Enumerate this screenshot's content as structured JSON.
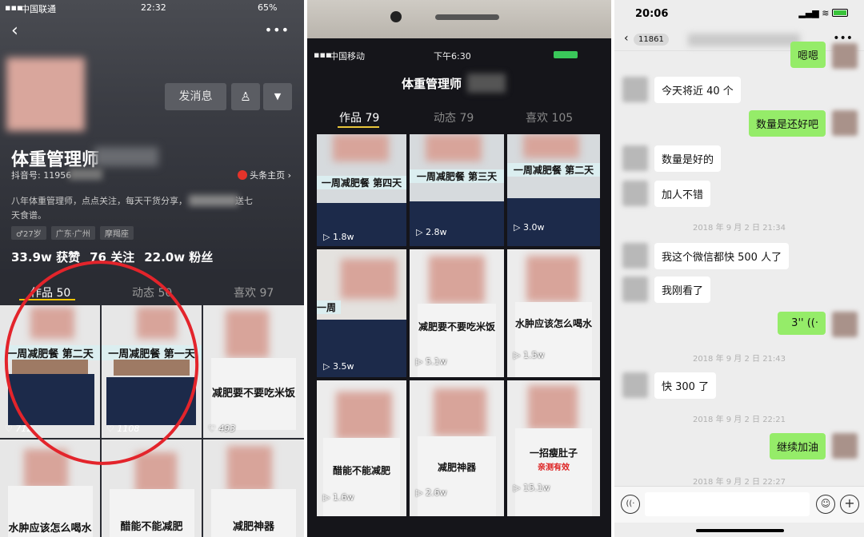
{
  "panel1": {
    "status": {
      "carrier": "中国联通",
      "time": "22:32",
      "battery": "65%"
    },
    "buttons": {
      "message": "发消息"
    },
    "profile": {
      "name": "体重管理师",
      "id_prefix": "抖音号: 11956",
      "toutiao": "头条主页 ›",
      "bio_line1": "八年体重管理师，点点关注，每天干货分享，",
      "bio_tail": "送七",
      "bio_line2": "天食谱。",
      "tags": [
        "♂27岁",
        "广东·广州",
        "摩羯座"
      ],
      "stats": [
        "33.9w 获赞",
        "76 关注",
        "22.0w 粉丝"
      ]
    },
    "tabs": [
      "作品 50",
      "动态 50",
      "喜欢 97"
    ],
    "grid": [
      {
        "label": "一周减肥餐 第二天",
        "likes": "♡ 712"
      },
      {
        "label": "一周减肥餐 第一天",
        "likes": "♡ 1108"
      },
      {
        "label": "减肥要不要吃米饭",
        "likes": "♡ 493"
      },
      {
        "label": "水肿应该怎么喝水",
        "likes": ""
      },
      {
        "label": "醋能不能减肥",
        "likes": ""
      },
      {
        "label": "减肥神器",
        "likes": ""
      }
    ],
    "highlight_color": "#e3242b"
  },
  "panel2": {
    "status": {
      "carrier": "中国移动",
      "time": "下午6:30"
    },
    "title": "体重管理师",
    "tabs": [
      "作品 79",
      "动态 79",
      "喜欢 105"
    ],
    "grid": [
      {
        "label": "一周减肥餐 第四天",
        "plays": "▷ 1.8w"
      },
      {
        "label": "一周减肥餐 第三天",
        "plays": "▷ 2.8w"
      },
      {
        "label": "一周减肥餐 第二天",
        "plays": "▷ 3.0w"
      },
      {
        "label": "一周",
        "plays": "▷ 3.5w"
      },
      {
        "label": "减肥要不要吃米饭",
        "plays": "▷ 5.1w"
      },
      {
        "label": "水肿应该怎么喝水",
        "plays": "▷ 1.5w"
      },
      {
        "label": "醋能不能减肥",
        "plays": "▷ 1.6w"
      },
      {
        "label": "减肥神器",
        "plays": "▷ 2.6w"
      },
      {
        "label": "一招瘦肚子",
        "sub": "亲测有效",
        "plays": "▷ 15.1w"
      }
    ]
  },
  "panel3": {
    "status": {
      "time": "20:06"
    },
    "badge": "11861",
    "messages": [
      {
        "side": "right",
        "text": "嗯嗯"
      },
      {
        "side": "left",
        "text": "今天将近 40 个"
      },
      {
        "side": "right",
        "text": "数量是还好吧"
      },
      {
        "side": "left",
        "text": "数量是好的"
      },
      {
        "side": "left",
        "text": "加人不错"
      },
      {
        "side": "time",
        "text": "2018 年 9 月 2 日 21:34"
      },
      {
        "side": "left",
        "text": "我这个微信都快 500 人了"
      },
      {
        "side": "left",
        "text": "我刚看了"
      },
      {
        "side": "right",
        "text": "3'' ((·"
      },
      {
        "side": "time",
        "text": "2018 年 9 月 2 日 21:43"
      },
      {
        "side": "left",
        "text": "快 300 了"
      },
      {
        "side": "time",
        "text": "2018 年 9 月 2 日 22:21"
      },
      {
        "side": "right",
        "text": "继续加油"
      },
      {
        "side": "time",
        "text": "2018 年 9 月 2 日 22:27"
      }
    ],
    "bubble_color": "#95ec69"
  }
}
